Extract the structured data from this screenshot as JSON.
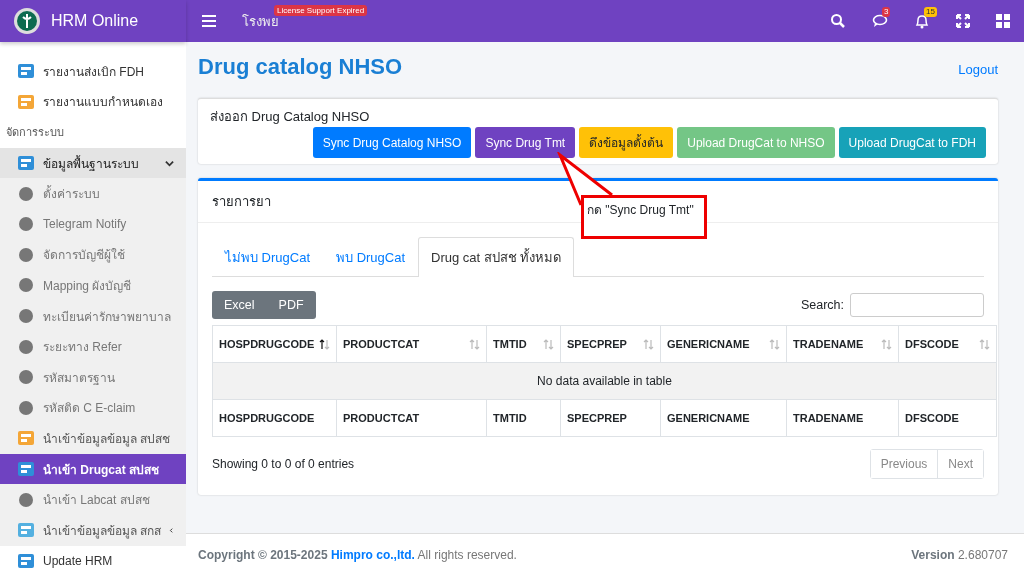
{
  "brand": {
    "title": "HRM Online"
  },
  "topbar": {
    "hospital": "โรงพย",
    "license_badge": "License Support Expired",
    "messages_count": "3",
    "notifications_count": "15"
  },
  "sidebar": {
    "items": [
      {
        "kind": "link",
        "label": "รายงานส่งเบิก FDH",
        "selected": false
      },
      {
        "kind": "link",
        "label": "รายงานแบบกำหนดเอง",
        "selected": false
      },
      {
        "kind": "section",
        "label": "จัดการระบบ"
      },
      {
        "kind": "group",
        "label": "ข้อมูลพื้นฐานระบบ",
        "expanded": true,
        "children": [
          {
            "kind": "link",
            "label": "ตั้งค่าระบบ",
            "selected": false
          },
          {
            "kind": "link",
            "label": "Telegram Notify",
            "selected": false
          },
          {
            "kind": "link",
            "label": "จัดการบัญชีผู้ใช้",
            "selected": false
          },
          {
            "kind": "link",
            "label": "Mapping ผังบัญชี",
            "selected": false
          },
          {
            "kind": "link",
            "label": "ทะเบียนค่ารักษาพยาบาล",
            "selected": false
          },
          {
            "kind": "link",
            "label": "ระยะทาง Refer",
            "selected": false
          },
          {
            "kind": "link",
            "label": "รหัสมาตรฐาน",
            "selected": false
          },
          {
            "kind": "link",
            "label": "รหัสติด C E-claim",
            "selected": false
          },
          {
            "kind": "group",
            "label": "นำเข้าข้อมูลข้อมูล สปสช",
            "expanded": true,
            "children": [
              {
                "kind": "link",
                "label": "นำเข้า Drugcat สปสช",
                "selected": true
              },
              {
                "kind": "link",
                "label": "นำเข้า Labcat สปสช",
                "selected": false
              }
            ]
          },
          {
            "kind": "group",
            "label": "นำเข้าข้อมูลข้อมูล สกส",
            "expanded": false
          }
        ]
      },
      {
        "kind": "link",
        "label": "Update HRM",
        "selected": false
      }
    ]
  },
  "page": {
    "title": "Drug catalog NHSO",
    "logout": "Logout"
  },
  "export_card": {
    "title": "ส่งออก Drug Catalog NHSO",
    "buttons": [
      {
        "label": "Sync Drug Catalog NHSO",
        "color": "#007bff"
      },
      {
        "label": "Sync Drug Tmt",
        "color": "#6f42c1"
      },
      {
        "label": "ดึงข้อมูลตั้งต้น",
        "color": "#ffc107"
      },
      {
        "label": "Upload DrugCat to NHSO",
        "color": "#74c686"
      },
      {
        "label": "Upload DrugCat to FDH",
        "color": "#17a2b8"
      }
    ]
  },
  "callout": {
    "text": "กด \"Sync Drug Tmt\""
  },
  "list_card": {
    "title": "รายการยา",
    "tabs": [
      {
        "label": "ไม่พบ DrugCat",
        "selected": false
      },
      {
        "label": "พบ DrugCat",
        "selected": false
      },
      {
        "label": "Drug cat สปสช ทั้งหมด",
        "selected": true
      }
    ],
    "export_buttons": [
      "Excel",
      "PDF"
    ],
    "search": {
      "label": "Search:"
    },
    "table": {
      "columns": [
        {
          "label": "HOSPDRUGCODE",
          "sorted": true
        },
        {
          "label": "PRODUCTCAT",
          "sorted": false
        },
        {
          "label": "TMTID",
          "sorted": false
        },
        {
          "label": "SPECPREP",
          "sorted": false
        },
        {
          "label": "GENERICNAME",
          "sorted": false
        },
        {
          "label": "TRADENAME",
          "sorted": false
        },
        {
          "label": "DFSCODE",
          "sorted": false
        }
      ],
      "empty_message": "No data available in table",
      "footer_columns": [
        "HOSPDRUGCODE",
        "PRODUCTCAT",
        "TMTID",
        "SPECPREP",
        "GENERICNAME",
        "TRADENAME",
        "DFSCODE"
      ]
    },
    "info": "Showing 0 to 0 of 0 entries",
    "pagination": [
      {
        "label": "Previous",
        "disabled": true
      },
      {
        "label": "Next",
        "disabled": true
      }
    ]
  },
  "footer": {
    "copyright": "Copyright © 2015-2025",
    "company": "Himpro co.,ltd.",
    "rights": "All rights reserved.",
    "version": "**Version** 2.680707"
  }
}
